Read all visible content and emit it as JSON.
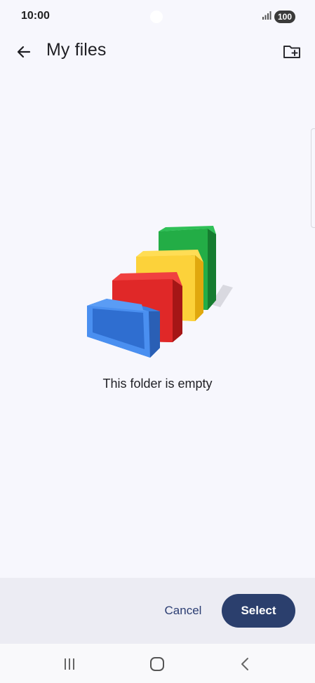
{
  "status_bar": {
    "time": "10:00",
    "battery": "100",
    "signal_icon": "signal-bars-icon"
  },
  "app_bar": {
    "back_icon": "arrow-left-icon",
    "title": "My files",
    "new_folder_icon": "create-folder-icon"
  },
  "empty_state": {
    "illustration": "empty-folders-illustration",
    "message": "This folder is empty",
    "colors": {
      "green": "#1e9e3e",
      "yellow": "#f9c520",
      "red": "#d21f1f",
      "blue": "#3c7fe0"
    }
  },
  "actions": {
    "cancel_label": "Cancel",
    "select_label": "Select"
  },
  "nav_bar": {
    "recents_icon": "recents-icon",
    "home_icon": "home-icon",
    "back_icon": "back-chevron-icon"
  },
  "colors": {
    "background": "#f7f7fd",
    "primary": "#2b3f6d",
    "action_bar": "#ececf3"
  }
}
